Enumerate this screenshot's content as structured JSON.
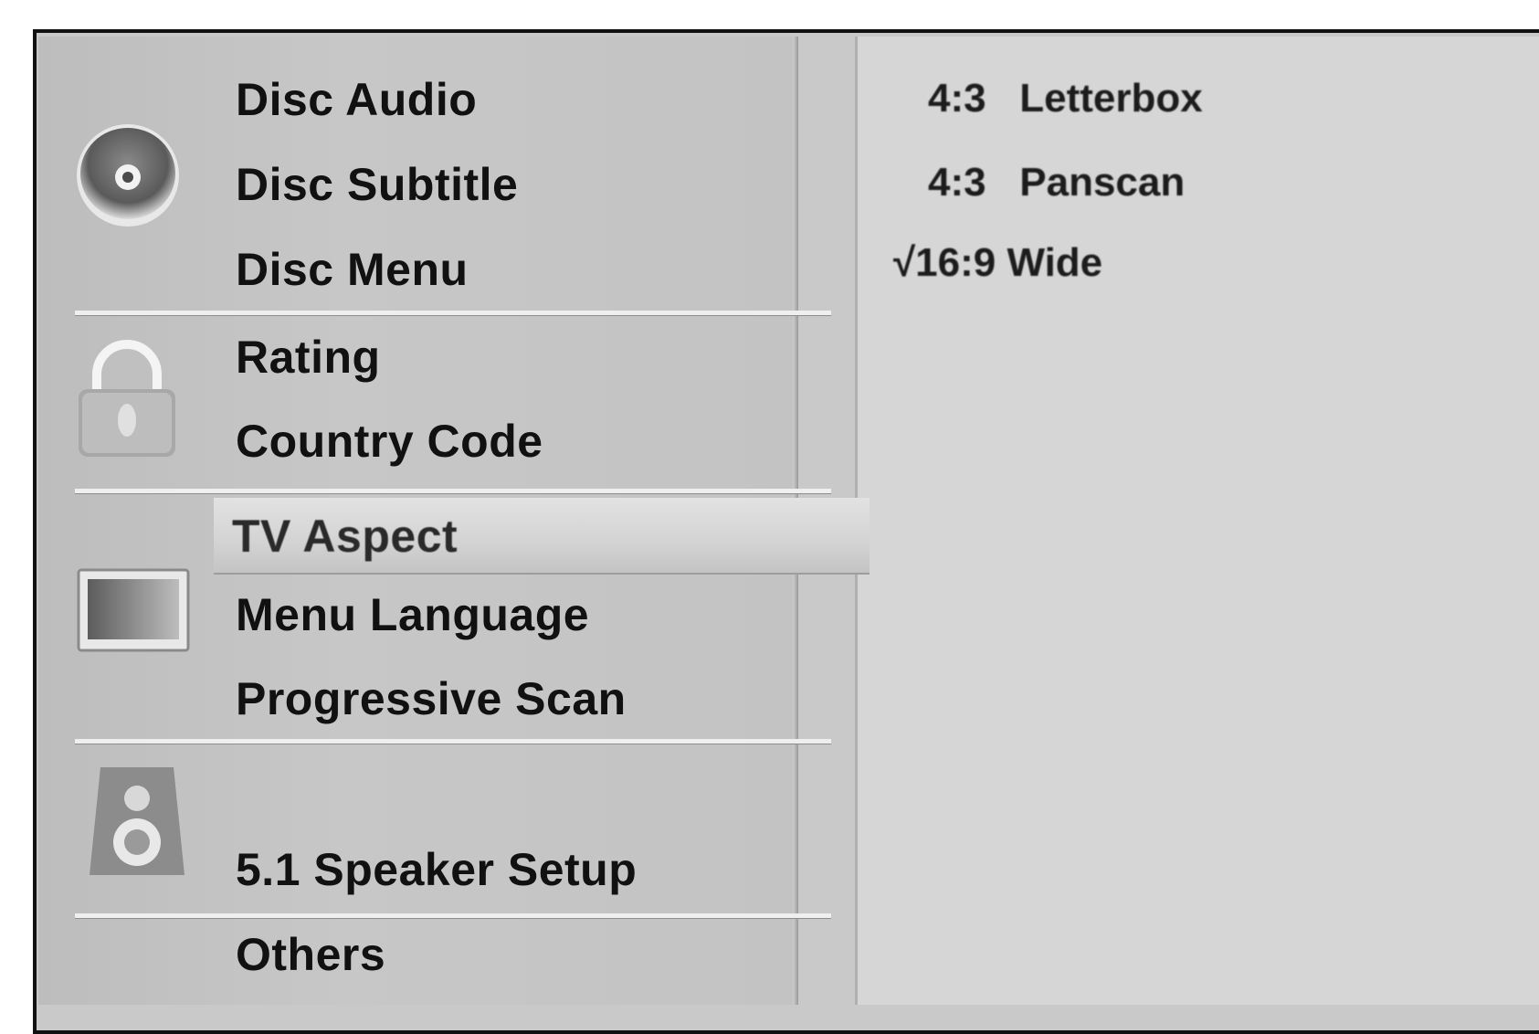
{
  "menu": {
    "items": [
      {
        "label": "Disc Audio"
      },
      {
        "label": "Disc Subtitle"
      },
      {
        "label": "Disc Menu"
      },
      {
        "label": "Rating"
      },
      {
        "label": "Country Code"
      },
      {
        "label": "TV Aspect",
        "selected": true
      },
      {
        "label": "Menu Language"
      },
      {
        "label": "Progressive Scan"
      },
      {
        "label": "5.1 Speaker Setup"
      },
      {
        "label": "Others"
      }
    ],
    "icons": [
      "disc-icon",
      "lock-icon",
      "tv-icon",
      "speaker-icon"
    ]
  },
  "options": {
    "items": [
      {
        "label": "4:3   Letterbox",
        "checked": false
      },
      {
        "label": "4:3   Panscan",
        "checked": false
      },
      {
        "label": "√16:9 Wide",
        "checked": true
      }
    ]
  }
}
